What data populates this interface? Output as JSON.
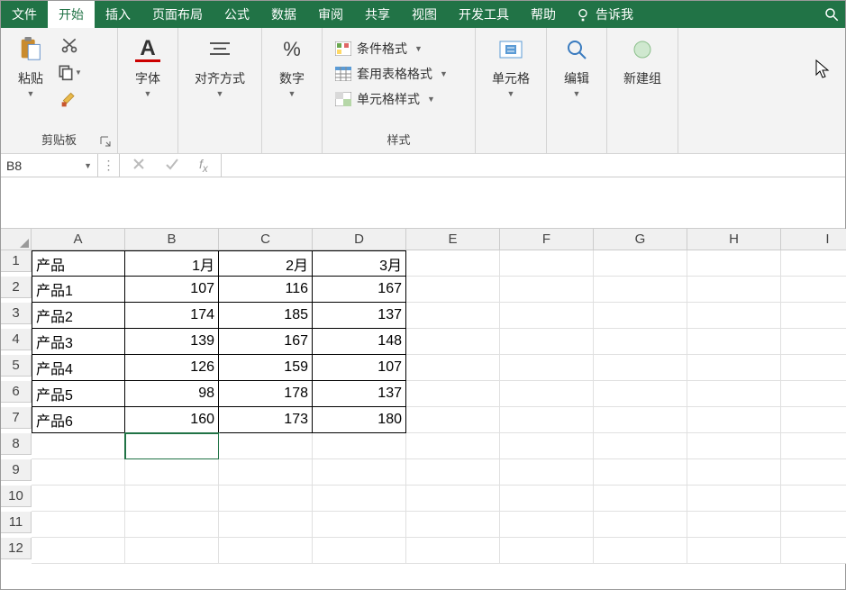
{
  "menu": {
    "tabs": [
      "文件",
      "开始",
      "插入",
      "页面布局",
      "公式",
      "数据",
      "审阅",
      "共享",
      "视图",
      "开发工具",
      "帮助"
    ],
    "active_index": 1,
    "tell_me": "告诉我"
  },
  "ribbon": {
    "clipboard": {
      "paste": "粘贴",
      "label": "剪贴板"
    },
    "font": {
      "label": "字体"
    },
    "alignment": {
      "label": "对齐方式"
    },
    "number": {
      "label": "数字"
    },
    "styles": {
      "conditional": "条件格式",
      "table": "套用表格格式",
      "cell": "单元格样式",
      "label": "样式"
    },
    "cells": {
      "label": "单元格"
    },
    "editing": {
      "label": "编辑"
    },
    "newgroup": {
      "label": "新建组"
    }
  },
  "namebox": "B8",
  "formula": "",
  "columns": [
    "A",
    "B",
    "C",
    "D",
    "E",
    "F",
    "G",
    "H",
    "I"
  ],
  "rows": [
    1,
    2,
    3,
    4,
    5,
    6,
    7,
    8,
    9,
    10,
    11,
    12
  ],
  "data": {
    "r1": {
      "A": "产品",
      "B": "1月",
      "C": "2月",
      "D": "3月"
    },
    "r2": {
      "A": "产品1",
      "B": "107",
      "C": "116",
      "D": "167"
    },
    "r3": {
      "A": "产品2",
      "B": "174",
      "C": "185",
      "D": "137"
    },
    "r4": {
      "A": "产品3",
      "B": "139",
      "C": "167",
      "D": "148"
    },
    "r5": {
      "A": "产品4",
      "B": "126",
      "C": "159",
      "D": "107"
    },
    "r6": {
      "A": "产品5",
      "B": "98",
      "C": "178",
      "D": "137"
    },
    "r7": {
      "A": "产品6",
      "B": "160",
      "C": "173",
      "D": "180"
    }
  },
  "selected_cell": "B8"
}
